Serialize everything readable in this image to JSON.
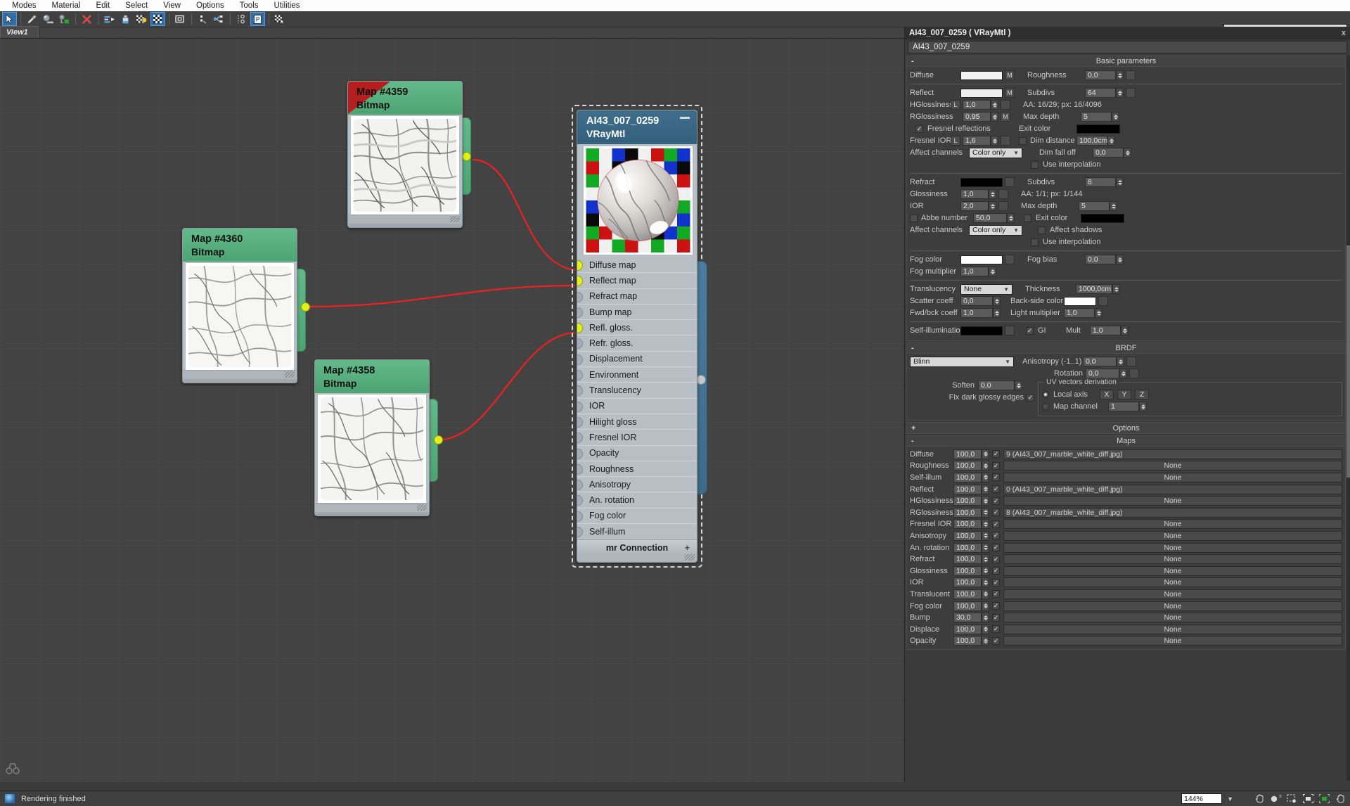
{
  "menu": {
    "items": [
      "Modes",
      "Material",
      "Edit",
      "Select",
      "View",
      "Options",
      "Tools",
      "Utilities"
    ]
  },
  "toolbar": {
    "buttons": [
      {
        "name": "select-tool",
        "icon": "arrow-cursor-icon",
        "active": true
      },
      {
        "name": "pick-material-tool",
        "icon": "eyedropper-icon",
        "active": false
      },
      {
        "name": "assign-material-tool",
        "icon": "sphere-assign-icon",
        "active": false
      },
      {
        "name": "show-in-viewport-tool",
        "icon": "sphere-cube-icon",
        "active": false
      },
      {
        "name": "delete-tool",
        "icon": "red-x-icon",
        "active": false
      },
      {
        "name": "move-children-tool",
        "icon": "move-arrow-icon",
        "active": false
      },
      {
        "name": "put-material-to-scene-tool",
        "icon": "paint-can-icon",
        "active": false
      },
      {
        "name": "show-background-tool",
        "icon": "checker-bulb-icon",
        "active": false
      },
      {
        "name": "show-checker-background-tool",
        "icon": "checker-icon",
        "active": true
      },
      {
        "name": "highlight-assets-tool",
        "icon": "square-node-icon",
        "active": false
      },
      {
        "name": "lay-out-children-tool",
        "icon": "dots-layout-icon",
        "active": false
      },
      {
        "name": "lay-out-all-tool",
        "icon": "tree-layout-icon",
        "active": false
      },
      {
        "name": "select-by-material-tool",
        "icon": "node-graph-icon",
        "active": false
      },
      {
        "name": "show-parameters-tool",
        "icon": "panel-icon",
        "active": true
      },
      {
        "name": "material-id-channel-tool",
        "icon": "checker-cursor-icon",
        "active": false
      }
    ],
    "view_selector_value": "View1"
  },
  "tabstrip": {
    "active_tab": "View1"
  },
  "nodes": {
    "bitmaps": [
      {
        "title": "Map #4359",
        "subtitle": "Bitmap",
        "flagged": true
      },
      {
        "title": "Map #4360",
        "subtitle": "Bitmap",
        "flagged": false
      },
      {
        "title": "Map #4358",
        "subtitle": "Bitmap",
        "flagged": false
      }
    ],
    "material": {
      "title": "AI43_007_0259",
      "subtitle": "VRayMtl",
      "footer_label": "mr Connection",
      "footer_plus": "+",
      "slots": [
        {
          "label": "Diffuse map",
          "connected": true
        },
        {
          "label": "Reflect map",
          "connected": true
        },
        {
          "label": "Refract map",
          "connected": false
        },
        {
          "label": "Bump map",
          "connected": false
        },
        {
          "label": "Refl. gloss.",
          "connected": true
        },
        {
          "label": "Refr. gloss.",
          "connected": false
        },
        {
          "label": "Displacement",
          "connected": false
        },
        {
          "label": "Environment",
          "connected": false
        },
        {
          "label": "Translucency",
          "connected": false
        },
        {
          "label": "IOR",
          "connected": false
        },
        {
          "label": "Hilight gloss",
          "connected": false
        },
        {
          "label": "Fresnel IOR",
          "connected": false
        },
        {
          "label": "Opacity",
          "connected": false
        },
        {
          "label": "Roughness",
          "connected": false
        },
        {
          "label": "Anisotropy",
          "connected": false
        },
        {
          "label": "An. rotation",
          "connected": false
        },
        {
          "label": "Fog color",
          "connected": false
        },
        {
          "label": "Self-illum",
          "connected": false
        }
      ]
    }
  },
  "panel": {
    "title": "AI43_007_0259  ( VRayMtl )",
    "close_label": "x",
    "material_name": "AI43_007_0259",
    "rollups": {
      "basic": {
        "header": "Basic parameters",
        "sign": "-",
        "diffuse_label": "Diffuse",
        "diffuse_m": "M",
        "roughness_label": "Roughness",
        "roughness_value": "0,0",
        "reflect_label": "Reflect",
        "reflect_m": "M",
        "subdivs_label": "Subdivs",
        "subdivs_value": "64",
        "hgloss_label": "HGlossiness",
        "hgloss_lock": "L",
        "hgloss_value": "1,0",
        "aa_reflect": "AA: 16/29; px: 16/4096",
        "rgloss_label": "RGlossiness",
        "rgloss_value": "0,95",
        "rgloss_m": "M",
        "maxdepth_label": "Max depth",
        "maxdepth_value": "5",
        "fresnel_label": "Fresnel reflections",
        "fresnel_checked": true,
        "exitcolor_label": "Exit color",
        "fresnel_ior_label": "Fresnel IOR",
        "fresnel_ior_lock": "L",
        "fresnel_ior_value": "1,6",
        "dimdist_label": "Dim distance",
        "dimdist_value": "100,0cm",
        "affect_label": "Affect channels",
        "affect_value": "Color only",
        "dimfall_label": "Dim fall off",
        "dimfall_value": "0,0",
        "useinterp_label": "Use interpolation",
        "refract_label": "Refract",
        "refract_subdivs_label": "Subdivs",
        "refract_subdivs_value": "8",
        "glossiness_label": "Glossiness",
        "glossiness_value": "1,0",
        "aa_refract": "AA: 1/1; px: 1/144",
        "ior_label": "IOR",
        "ior_value": "2,0",
        "refract_maxdepth_label": "Max depth",
        "refract_maxdepth_value": "5",
        "abbe_label": "Abbe number",
        "abbe_value": "50,0",
        "refract_exit_label": "Exit color",
        "refract_affect_label": "Affect channels",
        "refract_affect_value": "Color only",
        "affect_shadows_label": "Affect shadows",
        "refract_useinterp_label": "Use interpolation",
        "fogcolor_label": "Fog color",
        "fogbias_label": "Fog bias",
        "fogbias_value": "0,0",
        "fogmult_label": "Fog multiplier",
        "fogmult_value": "1,0",
        "translucency_label": "Translucency",
        "translucency_value": "None",
        "thickness_label": "Thickness",
        "thickness_value": "1000,0cm",
        "scatter_label": "Scatter coeff",
        "scatter_value": "0,0",
        "backside_label": "Back-side color",
        "fwdbck_label": "Fwd/bck coeff",
        "fwdbck_value": "1,0",
        "lightmult_label": "Light multiplier",
        "lightmult_value": "1,0",
        "selfillum_label": "Self-illumination",
        "gi_label": "GI",
        "gi_checked": true,
        "mult_label": "Mult",
        "mult_value": "1,0"
      },
      "brdf": {
        "header": "BRDF",
        "sign": "-",
        "type_value": "Blinn",
        "anisotropy_label": "Anisotropy (-1..1)",
        "anisotropy_value": "0,0",
        "rotation_label": "Rotation",
        "rotation_value": "0,0",
        "soften_label": "Soften",
        "soften_value": "0,0",
        "fixdark_label": "Fix dark glossy edges",
        "fixdark_checked": true,
        "uv_group_label": "UV vectors derivation",
        "localaxis_label": "Local axis",
        "axis_x": "X",
        "axis_y": "Y",
        "axis_z": "Z",
        "mapchannel_label": "Map channel",
        "mapchannel_value": "1"
      },
      "options": {
        "header": "Options",
        "sign": "+"
      },
      "maps": {
        "header": "Maps",
        "sign": "-",
        "rows": [
          {
            "label": "Diffuse",
            "amount": "100,0",
            "checked": true,
            "map": "9 (AI43_007_marble_white_diff.jpg)",
            "assigned": true
          },
          {
            "label": "Roughness",
            "amount": "100,0",
            "checked": true,
            "map": "None",
            "assigned": false
          },
          {
            "label": "Self-illum",
            "amount": "100,0",
            "checked": true,
            "map": "None",
            "assigned": false
          },
          {
            "label": "Reflect",
            "amount": "100,0",
            "checked": true,
            "map": "0 (AI43_007_marble_white_diff.jpg)",
            "assigned": true
          },
          {
            "label": "HGlossiness",
            "amount": "100,0",
            "checked": true,
            "map": "None",
            "assigned": false
          },
          {
            "label": "RGlossiness",
            "amount": "100,0",
            "checked": true,
            "map": "8 (AI43_007_marble_white_diff.jpg)",
            "assigned": true
          },
          {
            "label": "Fresnel IOR",
            "amount": "100,0",
            "checked": true,
            "map": "None",
            "assigned": false
          },
          {
            "label": "Anisotropy",
            "amount": "100,0",
            "checked": true,
            "map": "None",
            "assigned": false
          },
          {
            "label": "An. rotation",
            "amount": "100,0",
            "checked": true,
            "map": "None",
            "assigned": false
          },
          {
            "label": "Refract",
            "amount": "100,0",
            "checked": true,
            "map": "None",
            "assigned": false
          },
          {
            "label": "Glossiness",
            "amount": "100,0",
            "checked": true,
            "map": "None",
            "assigned": false
          },
          {
            "label": "IOR",
            "amount": "100,0",
            "checked": true,
            "map": "None",
            "assigned": false
          },
          {
            "label": "Translucent",
            "amount": "100,0",
            "checked": true,
            "map": "None",
            "assigned": false
          },
          {
            "label": "Fog color",
            "amount": "100,0",
            "checked": true,
            "map": "None",
            "assigned": false
          },
          {
            "label": "Bump",
            "amount": "30,0",
            "checked": true,
            "map": "None",
            "assigned": false
          },
          {
            "label": "Displace",
            "amount": "100,0",
            "checked": true,
            "map": "None",
            "assigned": false
          },
          {
            "label": "Opacity",
            "amount": "100,0",
            "checked": true,
            "map": "None",
            "assigned": false
          }
        ]
      }
    }
  },
  "statusbar": {
    "message": "Rendering finished",
    "zoom_value": "144%",
    "nav_buttons": [
      "pan-icon",
      "zoom-icon",
      "zoom-region-icon",
      "zoom-extents-icon",
      "zoom-extents-selected-icon",
      "pan-hand-icon"
    ]
  },
  "colors": {
    "bitmap_header": "#4da473",
    "material_header": "#33607c",
    "flag_red": "#b51f1f",
    "wire_red": "#f02020",
    "pip_yellow": "#e2ef18",
    "node_body": "#b8bfc4"
  }
}
